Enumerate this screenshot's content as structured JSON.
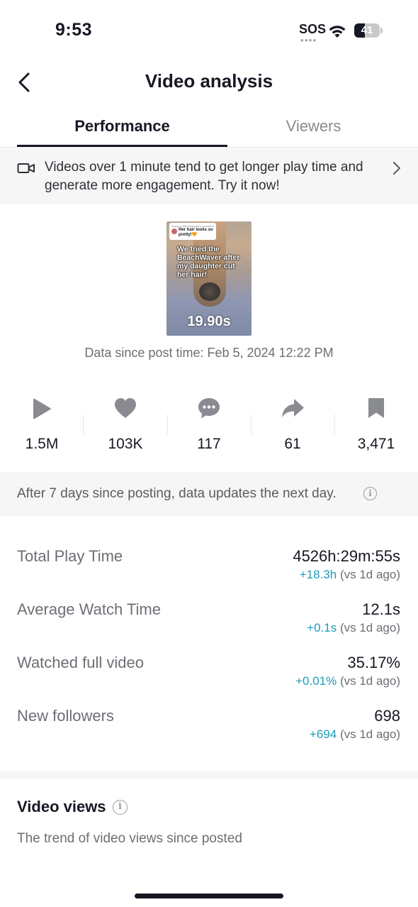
{
  "status_bar": {
    "time": "9:53",
    "sos": "SOS",
    "battery_percent": "41",
    "battery_level": 0.41
  },
  "header": {
    "title": "Video analysis"
  },
  "tabs": [
    {
      "label": "Performance",
      "active": true
    },
    {
      "label": "Viewers",
      "active": false
    }
  ],
  "tip": {
    "text": "Videos over 1 minute tend to get longer play time and generate more engagement. Try it now!"
  },
  "thumbnail": {
    "reply_header": "Reply to Itell Rhemant's comment",
    "reply_text": "Her hair looks so pretty!🧡",
    "caption": "We tried the BeachWaver after my daughter cut her hair!",
    "duration": "19.90s"
  },
  "post_time": "Data since post time: Feb 5, 2024 12:22 PM",
  "stats": [
    {
      "icon": "play-icon",
      "value": "1.5M"
    },
    {
      "icon": "heart-icon",
      "value": "103K"
    },
    {
      "icon": "comment-icon",
      "value": "117"
    },
    {
      "icon": "share-icon",
      "value": "61"
    },
    {
      "icon": "bookmark-icon",
      "value": "3,471"
    }
  ],
  "notice": {
    "text": "After 7 days since posting, data updates the next day."
  },
  "metrics": [
    {
      "label": "Total Play Time",
      "value": "4526h:29m:55s",
      "delta": "+18.3h",
      "comparison": "(vs 1d ago)"
    },
    {
      "label": "Average Watch Time",
      "value": "12.1s",
      "delta": "+0.1s",
      "comparison": "(vs 1d ago)"
    },
    {
      "label": "Watched full video",
      "value": "35.17%",
      "delta": "+0.01%",
      "comparison": "(vs 1d ago)"
    },
    {
      "label": "New followers",
      "value": "698",
      "delta": "+694",
      "comparison": "(vs 1d ago)"
    }
  ],
  "video_views": {
    "title": "Video views",
    "subtitle": "The trend of video views since posted"
  },
  "colors": {
    "accent_positive": "#1d9cb8",
    "text_primary": "#161823",
    "text_secondary": "#6d6e75",
    "icon_gray": "#8a8b91"
  }
}
